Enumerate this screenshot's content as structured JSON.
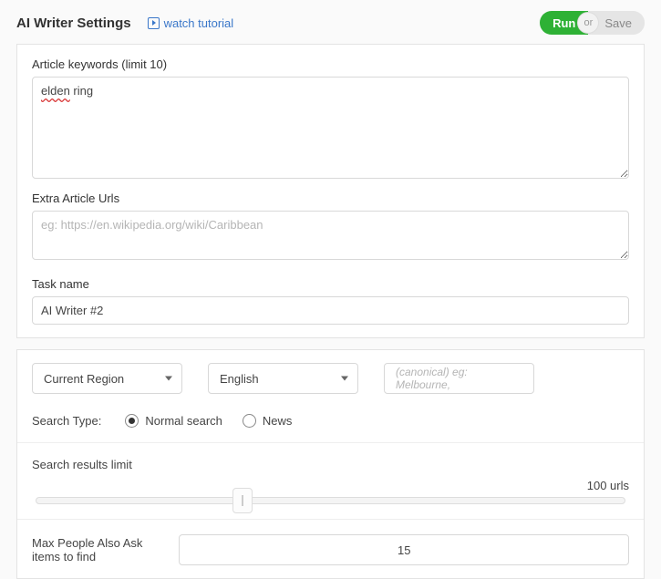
{
  "header": {
    "title": "AI Writer Settings",
    "tutorial_label": "watch tutorial",
    "run_label": "Run",
    "or_label": "or",
    "save_label": "Save"
  },
  "keywords": {
    "label": "Article keywords (limit 10)",
    "value_word1": "elden",
    "value_word2": " ring"
  },
  "extra_urls": {
    "label": "Extra Article Urls",
    "placeholder": "eg: https://en.wikipedia.org/wiki/Caribbean",
    "value": ""
  },
  "task_name": {
    "label": "Task name",
    "value": "AI Writer #2"
  },
  "region_select": {
    "value": "Current Region"
  },
  "language_select": {
    "value": "English"
  },
  "canonical": {
    "placeholder": "(canonical) eg: Melbourne,"
  },
  "search_type": {
    "label": "Search Type:",
    "options": [
      {
        "label": "Normal search",
        "checked": true
      },
      {
        "label": "News",
        "checked": false
      }
    ]
  },
  "search_limit": {
    "label": "Search results limit",
    "value_text": "100 urls"
  },
  "max_paa": {
    "label": "Max People Also Ask items to find",
    "value": "15"
  }
}
